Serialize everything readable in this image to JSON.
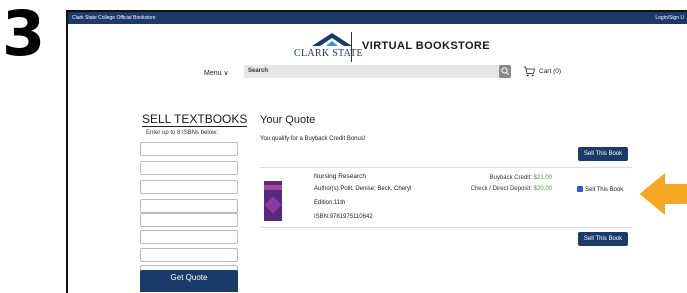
{
  "step_number": "3",
  "topbar": {
    "left": "Clark State College Official Bookstore",
    "right": "Login/Sign U"
  },
  "header": {
    "logo_text": "CLARK STATE",
    "site_title": "VIRTUAL BOOKSTORE",
    "menu_label": "Menu ∨",
    "search_placeholder": "Search",
    "cart_label": "Cart (0)"
  },
  "sell_panel": {
    "heading": "SELL TEXTBOOKS",
    "subheading": "Enter up to 8 ISBNs below:",
    "isbn_fields": [
      "",
      "",
      "",
      "",
      "",
      "",
      "",
      ""
    ],
    "submit_label": "Get Quote"
  },
  "quote": {
    "heading": "Your Quote",
    "bonus_text": "You qualify for a Buyback Credit Bonus!",
    "sell_button_label": "Sell This Book",
    "book": {
      "title": "Nursing Research",
      "authors": "Author(s):Polit, Denise; Beck, Cheryl",
      "edition": "Edition:11th",
      "isbn": "ISBN:9781975110642",
      "buyback_label": "Buyback Credit:",
      "buyback_value": "$21.00",
      "cash_label": "Check / Direct Deposit:",
      "cash_value": "$20.00",
      "checkbox_label": "Sell This Book",
      "checkbox_checked": true
    }
  },
  "colors": {
    "brand_navy": "#1a3a6a",
    "price_green": "#4a9a2a",
    "arrow_orange": "#f5a623"
  }
}
